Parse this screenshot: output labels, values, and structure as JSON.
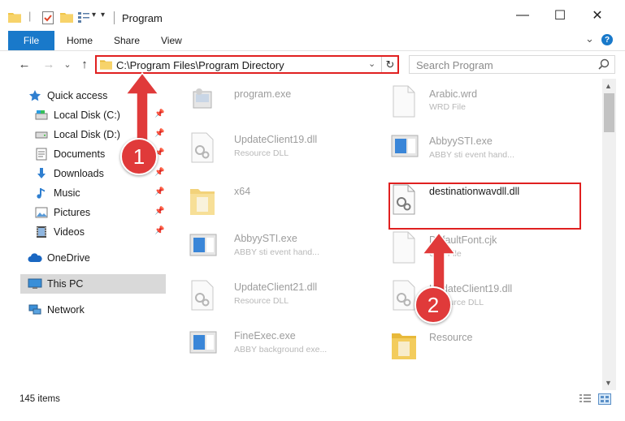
{
  "window": {
    "title": "Program",
    "minimize": "—",
    "maximize": "☐",
    "close": "✕"
  },
  "ribbon": {
    "tabs": [
      "File",
      "Home",
      "Share",
      "View"
    ],
    "expand": "⌄",
    "help": "?"
  },
  "address": {
    "back": "←",
    "forward": "→",
    "recent": "⌄",
    "up": "↑",
    "path": "C:\\Program Files\\Program Directory",
    "dropdown": "⌄",
    "refresh": "↻",
    "search_placeholder": "Search Program"
  },
  "nav": {
    "quick_access": "Quick access",
    "items": [
      {
        "label": "Local Disk (C:)",
        "icon": "local-disk-icon",
        "pinned": true
      },
      {
        "label": "Local Disk (D:)",
        "icon": "local-disk-icon",
        "pinned": true
      },
      {
        "label": "Documents",
        "icon": "documents-icon",
        "pinned": true
      },
      {
        "label": "Downloads",
        "icon": "downloads-icon",
        "pinned": true
      },
      {
        "label": "Music",
        "icon": "music-icon",
        "pinned": true
      },
      {
        "label": "Pictures",
        "icon": "pictures-icon",
        "pinned": true
      },
      {
        "label": "Videos",
        "icon": "videos-icon",
        "pinned": true
      }
    ],
    "onedrive": "OneDrive",
    "this_pc": "This PC",
    "network": "Network",
    "pin_glyph": "📌"
  },
  "files": {
    "left": [
      {
        "name": "program.exe",
        "desc": "",
        "icon": "program-exe-icon"
      },
      {
        "name": "UpdateClient19.dll",
        "desc": "Resource DLL",
        "icon": "dll-icon"
      },
      {
        "name": "x64",
        "desc": "",
        "icon": "folder-icon"
      },
      {
        "name": "AbbyySTI.exe",
        "desc": "ABBY sti event hand...",
        "icon": "exe-icon"
      },
      {
        "name": "UpdateClient21.dll",
        "desc": "Resource DLL",
        "icon": "dll-icon"
      },
      {
        "name": "FineExec.exe",
        "desc": "ABBY background exe...",
        "icon": "exe-icon"
      }
    ],
    "right": [
      {
        "name": "Arabic.wrd",
        "desc": "WRD File",
        "icon": "file-icon"
      },
      {
        "name": "AbbyySTI.exe",
        "desc": "ABBY sti event hand...",
        "icon": "exe-icon"
      },
      {
        "name": "destinationwavdll.dll",
        "desc": "",
        "icon": "dll-icon"
      },
      {
        "name": "DefaultFont.cjk",
        "desc": "CJK File",
        "icon": "file-icon"
      },
      {
        "name": "UpdateClient19.dll",
        "desc": "Resource DLL",
        "icon": "dll-icon"
      },
      {
        "name": "Resource",
        "desc": "",
        "icon": "folder-icon"
      }
    ]
  },
  "annotations": {
    "step1": "1",
    "step2": "2"
  },
  "status": {
    "count": "145 items"
  },
  "colors": {
    "accent": "#1979ca",
    "highlight": "#e02020",
    "badge": "#e03a3a"
  }
}
